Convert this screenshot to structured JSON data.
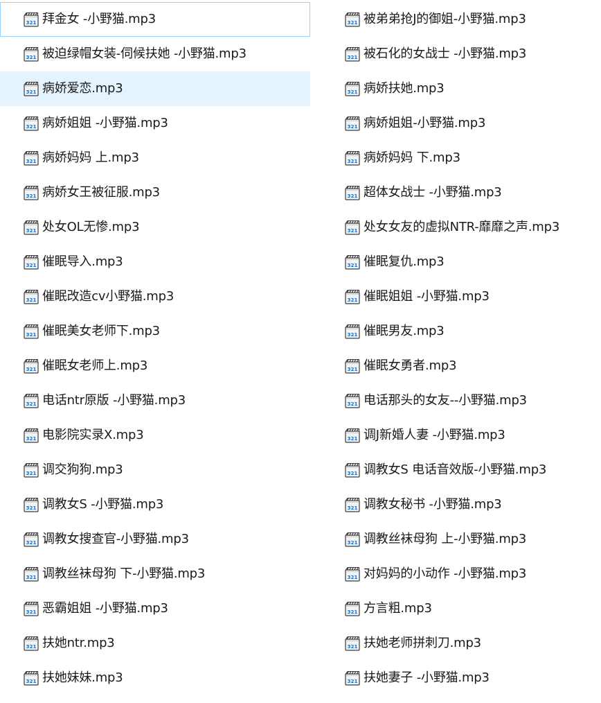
{
  "icon": "media-audio-file-icon",
  "colors": {
    "hover_bg": "#e5f3ff",
    "focus_border": "#99d1ff",
    "text": "#1a1a1a"
  },
  "state": {
    "focused_item": "拜金女 -小野猫.mp3",
    "hovered_item": "病娇爱恋.mp3"
  },
  "left_column": [
    "拜金女 -小野猫.mp3",
    "被迫绿帽女装-伺候扶她 -小野猫.mp3",
    "病娇爱恋.mp3",
    "病娇姐姐 -小野猫.mp3",
    "病娇妈妈 上.mp3",
    "病娇女王被征服.mp3",
    "处女OL无惨.mp3",
    "催眠导入.mp3",
    "催眠改造cv小野猫.mp3",
    "催眠美女老师下.mp3",
    "催眠女老师上.mp3",
    "电话ntr原版 -小野猫.mp3",
    "电影院实录X.mp3",
    "调交狗狗.mp3",
    "调教女S -小野猫.mp3",
    "调教女搜查官-小野猫.mp3",
    "调教丝袜母狗 下-小野猫.mp3",
    "恶霸姐姐 -小野猫.mp3",
    "扶她ntr.mp3",
    "扶她妹妹.mp3"
  ],
  "right_column": [
    "被弟弟抢J的御姐-小野猫.mp3",
    "被石化的女战士 -小野猫.mp3",
    "病娇扶她.mp3",
    "病娇姐姐-小野猫.mp3",
    "病娇妈妈 下.mp3",
    "超体女战士 -小野猫.mp3",
    "处女女友的虚拟NTR-靡靡之声.mp3",
    "催眠复仇.mp3",
    "催眠姐姐 -小野猫.mp3",
    "催眠男友.mp3",
    "催眠女勇者.mp3",
    "电话那头的女友--小野猫.mp3",
    "调J新婚人妻 -小野猫.mp3",
    "调教女S 电话音效版-小野猫.mp3",
    "调教女秘书 -小野猫.mp3",
    "调教丝袜母狗 上-小野猫.mp3",
    "对妈妈的小动作 -小野猫.mp3",
    "方言粗.mp3",
    "扶她老师拼刺刀.mp3",
    "扶她妻子 -小野猫.mp3"
  ]
}
